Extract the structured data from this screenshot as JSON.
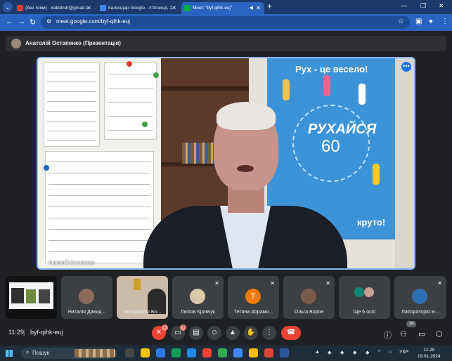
{
  "browser": {
    "tabs": [
      {
        "label": "(без теми) - kabidndr@gmail.c",
        "favicon_color": "#ea4335",
        "active": false
      },
      {
        "label": "Календар Google - п'ятниця, 1",
        "favicon_color": "#4285f4",
        "active": false
      },
      {
        "label": "Meet: \"byf-qihk-euj\"",
        "favicon_color": "#00ac47",
        "active": true
      }
    ],
    "new_tab": "+",
    "url": "meet.google.com/byf-qihk-euj"
  },
  "presenter": {
    "label": "Анатолій Остапенко (Презентація)"
  },
  "stage": {
    "speaker_label": "Анатолій Остапенко",
    "poster_heading": "Рух - це весело!",
    "poster_big": "РУХАЙСЯ",
    "poster_number": "60",
    "poster_footer": "круто!",
    "more_glyph": "•••"
  },
  "tiles": [
    {
      "name": "",
      "type": "screen",
      "muted": true
    },
    {
      "name": "Наталія Давид...",
      "type": "photo",
      "color": "#8b6a5a",
      "muted": false
    },
    {
      "name": "Володимир Бо...",
      "type": "video",
      "color": "#c9b9a6",
      "muted": false
    },
    {
      "name": "Любов Кривчук",
      "type": "photo",
      "color": "#d8c7a8",
      "muted": true
    },
    {
      "name": "Тетяна Абрамо...",
      "type": "letter",
      "letter": "T",
      "color": "#f57c00",
      "muted": true
    },
    {
      "name": "Ольга Ворон",
      "type": "photo",
      "color": "#7a5a4a",
      "muted": true
    },
    {
      "name": "Ще 6 осіб",
      "type": "group",
      "color": "#12857a",
      "muted": false
    },
    {
      "name": "Лабораторія ін...",
      "type": "photo",
      "color": "#2d6fb0",
      "muted": true
    }
  ],
  "controls": {
    "time": "11:29",
    "separator": "|",
    "meeting_code": "byf-qihk-euj",
    "mic_badge": "!",
    "cam_badge": "!",
    "participants_count": "14"
  },
  "taskbar": {
    "search_label": "Пошук",
    "language": "УКР",
    "clock_time": "11:29",
    "clock_date": "19.01.2024"
  },
  "colors": {
    "accent": "#8ab4f8",
    "end_call": "#ea4335",
    "tab_bar": "#1b3a6b"
  }
}
